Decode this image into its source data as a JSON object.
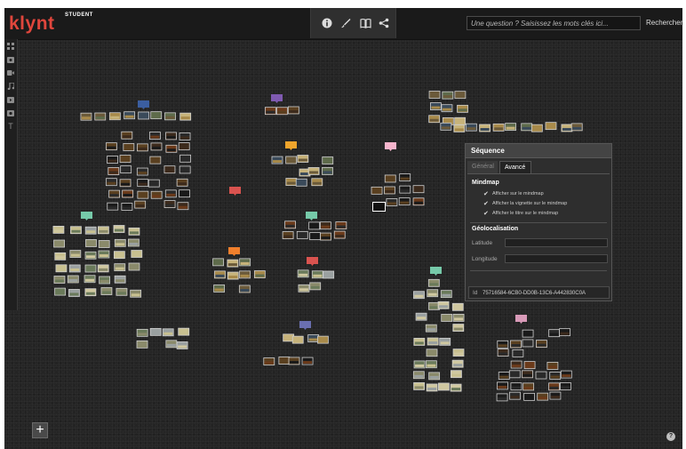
{
  "app": {
    "logo": "klynt",
    "edition": "STUDENT"
  },
  "search": {
    "placeholder": "Une question ? Saisissez les mots clés ici...",
    "button_label": "Rechercher"
  },
  "toolbar": {
    "icons": [
      "info-icon",
      "brush-icon",
      "book-icon",
      "share-icon"
    ]
  },
  "sidebar": {
    "icons": [
      "grid-icon",
      "image-icon",
      "video-icon",
      "music-icon",
      "play-icon",
      "clapper-icon",
      "text-icon"
    ]
  },
  "panel": {
    "title": "Séquence",
    "tabs": [
      "Général",
      "Avancé"
    ],
    "active_tab": "Avancé",
    "mindmap": {
      "heading": "Mindmap",
      "options": [
        {
          "label": "Afficher sur le mindmap",
          "checked": true
        },
        {
          "label": "Afficher la vignette sur le mindmap",
          "checked": true
        },
        {
          "label": "Afficher le titre sur le mindmap",
          "checked": true
        }
      ]
    },
    "geo": {
      "heading": "Géolocalisation",
      "latitude_label": "Latitude",
      "longitude_label": "Longitude",
      "latitude_value": "",
      "longitude_value": ""
    },
    "id_label": "Id",
    "id_value": "75716584-6CB0-DD0B-13C6-A442830C0A"
  },
  "colors": {
    "brand": "#e0463c",
    "background": "#252525",
    "group_colors": [
      "#3b5ea0",
      "#7f5ab0",
      "#f0a52c",
      "#f5b4cc",
      "#d9534f",
      "#76c9a9",
      "#f07f2c",
      "#d9534f",
      "#76c9a9",
      "#6a6fb0",
      "#76c9a9",
      "#d89ab8"
    ]
  },
  "actions": {
    "add": "+",
    "help": "?"
  }
}
